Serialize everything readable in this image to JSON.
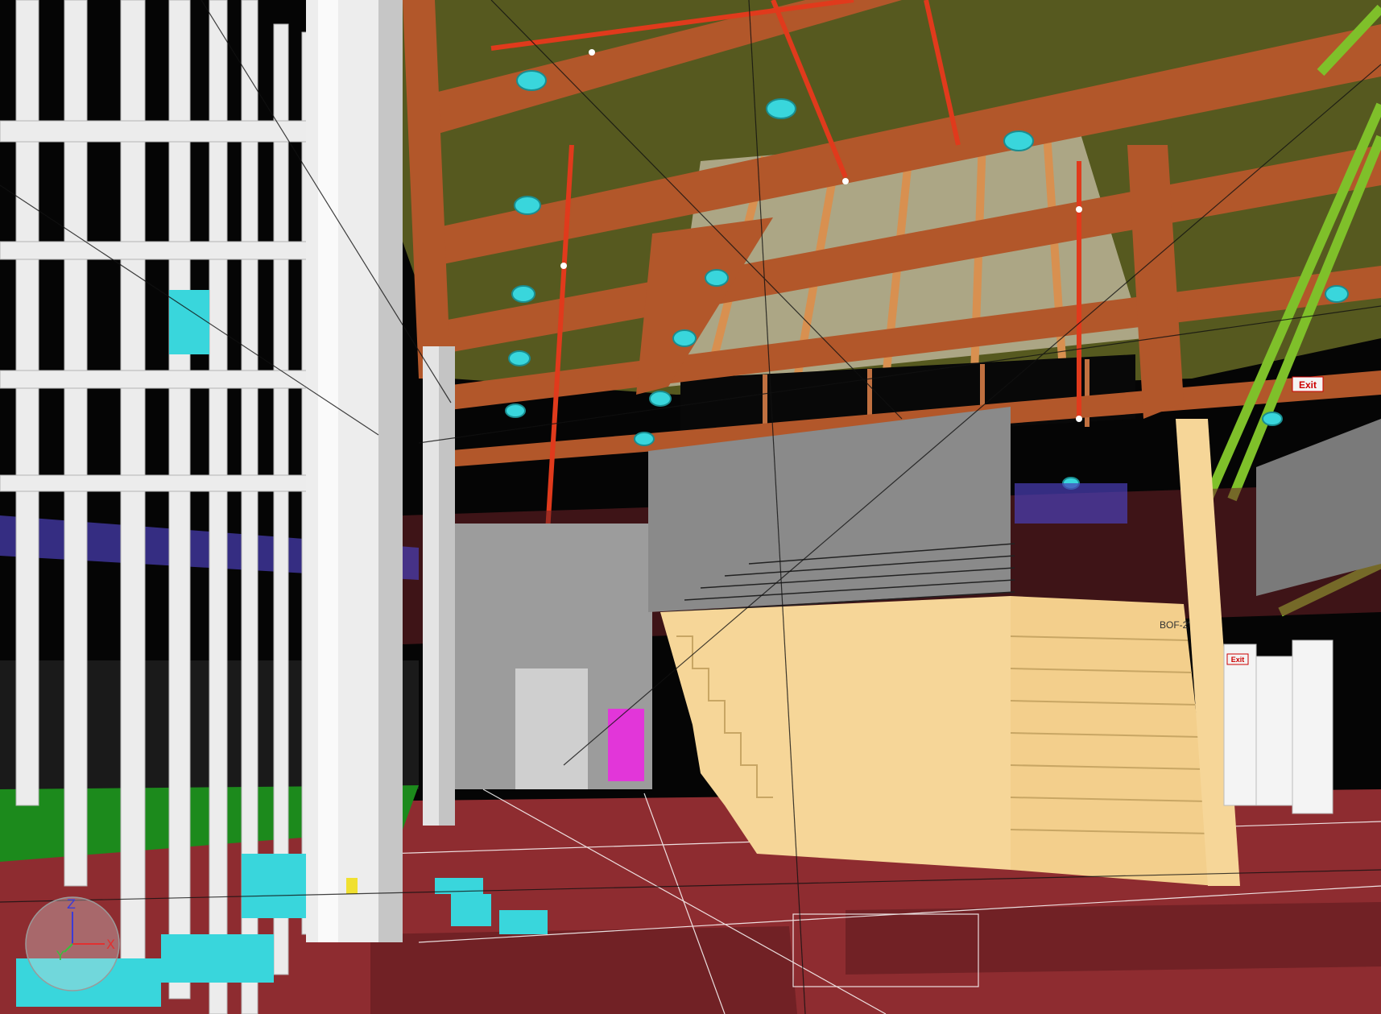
{
  "view": {
    "type": "3d-model-viewport",
    "colors": {
      "ceiling": "#56591f",
      "beam": "#b2572a",
      "floor": "#8e2c30",
      "stair": "#f6d698",
      "column": "#f2f2f2",
      "glass": "#c9c0a8",
      "duct_cyan": "#39d6dc",
      "pipe_green": "#7fc02a",
      "sprinkler_red": "#e03a1c",
      "wall_grey": "#8a8a8a",
      "dark_void": "#050505"
    }
  },
  "signs": {
    "exit_upper": "Exit",
    "exit_lower": "Exit"
  },
  "annotations": {
    "level_tag": "BOF-2'"
  },
  "axis_gizmo": {
    "z_label": "Z",
    "y_label": "Y",
    "x_label": "X",
    "z_color": "#3b3bd8",
    "y_color": "#36c23a",
    "x_color": "#e23030"
  }
}
